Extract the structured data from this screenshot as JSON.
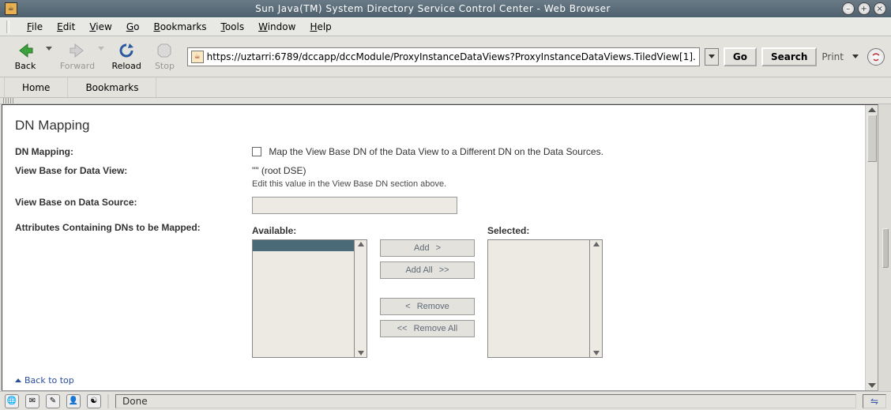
{
  "window": {
    "title": "Sun Java(TM) System Directory Service Control Center - Web Browser"
  },
  "menu": {
    "file": "File",
    "edit": "Edit",
    "view": "View",
    "go": "Go",
    "bookmarks": "Bookmarks",
    "tools": "Tools",
    "window": "Window",
    "help": "Help"
  },
  "toolbar": {
    "back": "Back",
    "forward": "Forward",
    "reload": "Reload",
    "stop": "Stop",
    "go": "Go",
    "search": "Search",
    "print": "Print"
  },
  "url": "https://uztarri:6789/dccapp/dccModule/ProxyInstanceDataViews?ProxyInstanceDataViews.TiledView[1].",
  "bmbar": {
    "home": "Home",
    "bookmarks": "Bookmarks"
  },
  "page": {
    "heading": "DN Mapping",
    "rows": {
      "dnmapping": {
        "label": "DN Mapping:",
        "chk_text": "Map the View Base DN of the Data View to a Different DN on the Data Sources."
      },
      "vbdv": {
        "label": "View Base for Data View:",
        "value": "\"\" (root DSE)",
        "hint": "Edit this value in the View Base DN section above."
      },
      "vbds": {
        "label": "View Base on Data Source:"
      },
      "attrs": {
        "label": "Attributes Containing DNs to be Mapped:"
      }
    },
    "picker": {
      "available": "Available:",
      "selected": "Selected:",
      "add": "Add",
      "add_sym": ">",
      "addall": "Add All",
      "addall_sym": ">>",
      "remove": "Remove",
      "remove_sym": "<",
      "removeall": "Remove All",
      "removeall_sym": "<<"
    },
    "backtop": "Back to top"
  },
  "status": {
    "done": "Done"
  }
}
